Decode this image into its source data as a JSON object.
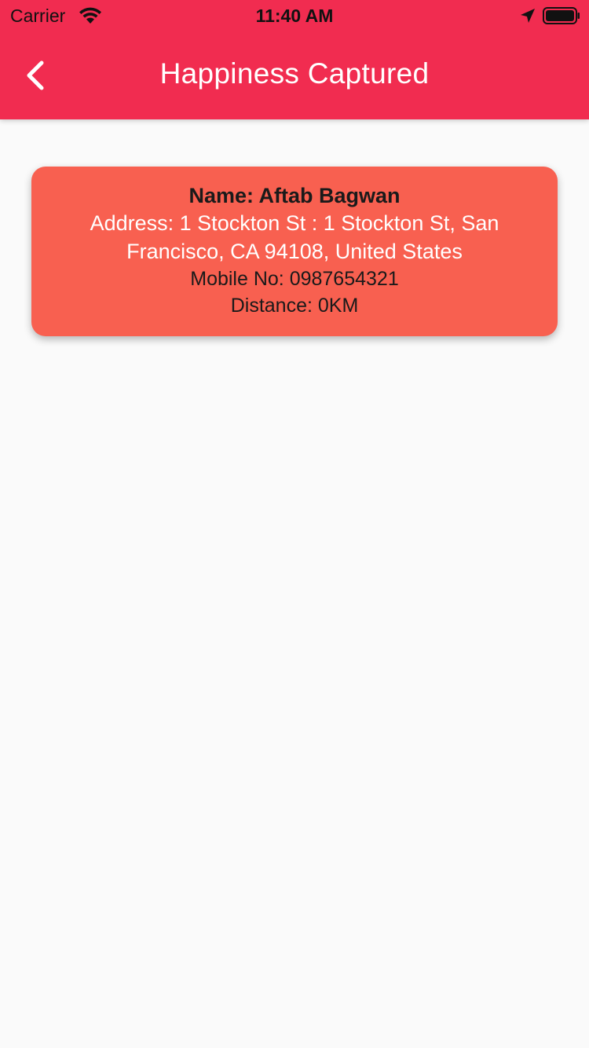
{
  "status_bar": {
    "carrier": "Carrier",
    "time": "11:40 AM",
    "wifi_icon": "wifi-icon",
    "location_icon": "location-arrow-icon",
    "battery_icon": "battery-full-icon"
  },
  "nav": {
    "title": "Happiness Captured",
    "back_icon": "chevron-left-icon"
  },
  "card": {
    "name": "Name: Aftab Bagwan",
    "address": "Address: 1 Stockton St : 1 Stockton St, San Francisco, CA  94108, United States",
    "mobile": "Mobile No: 0987654321",
    "distance": "Distance: 0KM"
  },
  "colors": {
    "app_bar": "#f12c50",
    "card": "#f86050",
    "background": "#fafafa"
  }
}
